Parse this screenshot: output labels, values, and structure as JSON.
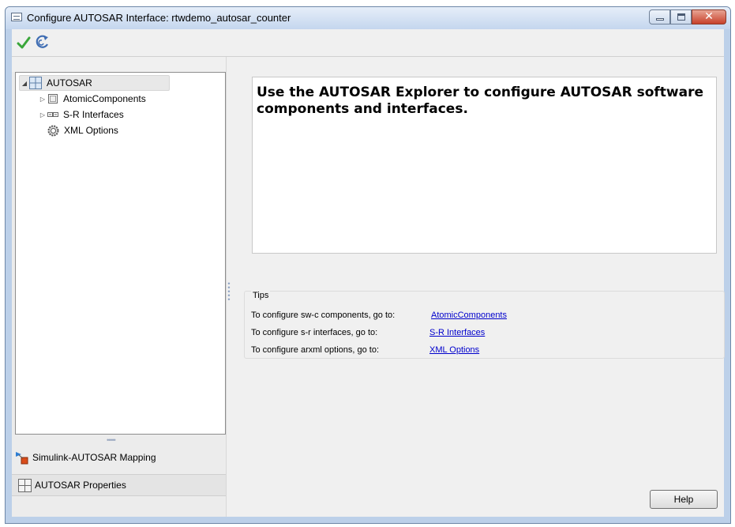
{
  "window": {
    "title": "Configure AUTOSAR Interface: rtwdemo_autosar_counter"
  },
  "toolbar": {
    "apply_icon": "check-icon",
    "refresh_icon": "refresh-icon"
  },
  "tree": {
    "root": "AUTOSAR",
    "items": [
      {
        "label": "AtomicComponents",
        "icon": "component-icon",
        "expandable": true
      },
      {
        "label": "S-R Interfaces",
        "icon": "interface-icon",
        "expandable": true
      },
      {
        "label": "XML Options",
        "icon": "gear-icon",
        "expandable": false
      }
    ]
  },
  "bottom_nav": {
    "mapping": "Simulink-AUTOSAR Mapping",
    "properties": "AUTOSAR Properties"
  },
  "welcome": {
    "text": "Use the AUTOSAR Explorer to configure AUTOSAR software components and interfaces."
  },
  "tips": {
    "title": "Tips",
    "rows": [
      {
        "label": "To configure sw-c components, go to:",
        "link": "AtomicComponents"
      },
      {
        "label": "To configure s-r interfaces, go to:",
        "link": "S-R Interfaces"
      },
      {
        "label": "To configure arxml options, go to:",
        "link": "XML Options"
      }
    ]
  },
  "buttons": {
    "help": "Help"
  }
}
